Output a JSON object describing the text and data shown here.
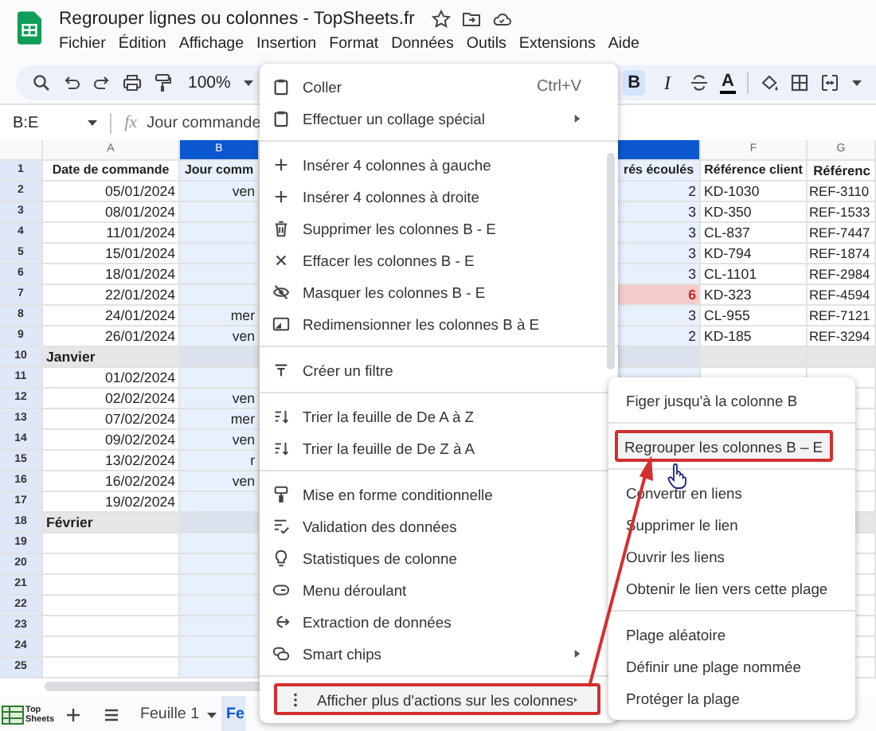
{
  "app": {
    "title": "Regrouper lignes ou colonnes - TopSheets.fr",
    "menus": [
      "Fichier",
      "Édition",
      "Affichage",
      "Insertion",
      "Format",
      "Données",
      "Outils",
      "Extensions",
      "Aide"
    ]
  },
  "toolbar": {
    "zoom": "100%",
    "format_buttons": [
      {
        "label": "B",
        "selected": true
      },
      {
        "label": "I",
        "selected": false
      }
    ],
    "text_color": "A"
  },
  "formula_bar": {
    "range": "B:E",
    "fx": "fx",
    "content": "Jour commande"
  },
  "grid": {
    "columns": [
      {
        "label": "A",
        "selected": false
      },
      {
        "label": "B",
        "selected": true
      },
      {
        "selected": true
      },
      {
        "label": "F",
        "selected": false
      },
      {
        "label": "G",
        "selected": false
      }
    ],
    "rows": [
      {
        "number": "1",
        "kind": "header",
        "cells": [
          "Date de commande",
          "Jour comm",
          "rés écoulés",
          "Référence client",
          "Référenc"
        ],
        "alert": false
      },
      {
        "number": "2",
        "kind": "data",
        "cells": [
          "05/01/2024",
          "ven",
          "2",
          "KD-1030",
          "REF-3110"
        ],
        "alert": false
      },
      {
        "number": "3",
        "kind": "data",
        "cells": [
          "08/01/2024",
          null,
          "3",
          "KD-350",
          "REF-1533"
        ],
        "alert": false
      },
      {
        "number": "4",
        "kind": "data",
        "cells": [
          "11/01/2024",
          null,
          "3",
          "CL-837",
          "REF-7447"
        ],
        "alert": false
      },
      {
        "number": "5",
        "kind": "data",
        "cells": [
          "15/01/2024",
          null,
          "3",
          "KD-794",
          "REF-1874"
        ],
        "alert": false
      },
      {
        "number": "6",
        "kind": "data",
        "cells": [
          "18/01/2024",
          null,
          "3",
          "CL-1101",
          "REF-2984"
        ],
        "alert": false
      },
      {
        "number": "7",
        "kind": "data",
        "cells": [
          "22/01/2024",
          null,
          "6",
          "KD-323",
          "REF-4594"
        ],
        "alert": true
      },
      {
        "number": "8",
        "kind": "data",
        "cells": [
          "24/01/2024",
          "mer",
          "3",
          "CL-955",
          "REF-7121"
        ],
        "alert": false
      },
      {
        "number": "9",
        "kind": "data",
        "cells": [
          "26/01/2024",
          "ven",
          "2",
          "KD-185",
          "REF-3294"
        ],
        "alert": false
      },
      {
        "number": "10",
        "kind": "group",
        "cells": [
          "Janvier",
          null,
          null,
          null,
          null
        ],
        "alert": false
      },
      {
        "number": "11",
        "kind": "data",
        "cells": [
          "01/02/2024",
          null,
          null,
          null,
          null
        ]
      },
      {
        "number": "12",
        "kind": "data",
        "cells": [
          "02/02/2024",
          "ven",
          null,
          null,
          null
        ]
      },
      {
        "number": "13",
        "kind": "data",
        "cells": [
          "07/02/2024",
          "mer",
          null,
          null,
          null
        ]
      },
      {
        "number": "14",
        "kind": "data",
        "cells": [
          "09/02/2024",
          "ven",
          null,
          null,
          null
        ]
      },
      {
        "number": "15",
        "kind": "data",
        "cells": [
          "13/02/2024",
          "r",
          null,
          null,
          null
        ]
      },
      {
        "number": "16",
        "kind": "data",
        "cells": [
          "16/02/2024",
          "ven",
          null,
          null,
          null
        ]
      },
      {
        "number": "17",
        "kind": "data",
        "cells": [
          "19/02/2024",
          null,
          null,
          null,
          null
        ]
      },
      {
        "number": "18",
        "kind": "group",
        "cells": [
          "Février",
          null,
          null,
          null,
          null
        ]
      },
      {
        "number": "19",
        "kind": "data",
        "cells": [
          null,
          null,
          null,
          null,
          null
        ]
      },
      {
        "number": "20",
        "kind": "data",
        "cells": [
          null,
          null,
          null,
          null,
          null
        ]
      },
      {
        "number": "21",
        "kind": "data",
        "cells": [
          null,
          null,
          null,
          null,
          null
        ]
      },
      {
        "number": "22",
        "kind": "data",
        "cells": [
          null,
          null,
          null,
          null,
          null
        ]
      },
      {
        "number": "23",
        "kind": "data",
        "cells": [
          null,
          null,
          null,
          null,
          null
        ]
      },
      {
        "number": "24",
        "kind": "data",
        "cells": [
          null,
          null,
          null,
          null,
          null
        ]
      },
      {
        "number": "25",
        "kind": "data",
        "cells": [
          null,
          null,
          null,
          null,
          null
        ]
      }
    ]
  },
  "sheet_bar": {
    "logo_text": "Top Sheets",
    "tabs": [
      {
        "label": "Feuille 1",
        "selected": false
      },
      {
        "label": "Fe",
        "selected": true
      }
    ]
  },
  "context_menu": {
    "groups": [
      [
        {
          "label": "Coller",
          "shortcut": "Ctrl+V",
          "submenu": false,
          "highlighted": false
        },
        {
          "label": "Effectuer un collage spécial",
          "submenu": true,
          "highlighted": false
        }
      ],
      [
        {
          "label": "Insérer 4 colonnes à gauche",
          "submenu": false,
          "highlighted": false
        },
        {
          "label": "Insérer 4 colonnes à droite",
          "submenu": false,
          "highlighted": false
        },
        {
          "label": "Supprimer les colonnes B - E",
          "submenu": false,
          "highlighted": false
        },
        {
          "label": "Effacer les colonnes B - E",
          "submenu": false,
          "highlighted": false
        },
        {
          "label": "Masquer les colonnes B - E",
          "submenu": false,
          "highlighted": false
        },
        {
          "label": "Redimensionner les colonnes B à E",
          "submenu": false,
          "highlighted": false
        }
      ],
      [
        {
          "label": "Créer un filtre",
          "submenu": false,
          "highlighted": false
        }
      ],
      [
        {
          "label": "Trier la feuille de De A à Z",
          "submenu": false,
          "highlighted": false
        },
        {
          "label": "Trier la feuille de De Z à A",
          "submenu": false,
          "highlighted": false
        }
      ],
      [
        {
          "label": "Mise en forme conditionnelle",
          "submenu": false,
          "highlighted": false
        },
        {
          "label": "Validation des données",
          "submenu": false,
          "highlighted": false
        },
        {
          "label": "Statistiques de colonne",
          "submenu": false,
          "highlighted": false
        },
        {
          "label": "Menu déroulant",
          "submenu": false,
          "highlighted": false
        },
        {
          "label": "Extraction de données",
          "submenu": false,
          "highlighted": false
        },
        {
          "label": "Smart chips",
          "submenu": true,
          "highlighted": false
        }
      ],
      [
        {
          "label": "Afficher plus d'actions sur les colonnes",
          "submenu": true,
          "highlighted": true
        }
      ]
    ]
  },
  "submenu": {
    "groups": [
      [
        {
          "label": "Figer jusqu'à la colonne B",
          "highlighted": false
        }
      ],
      [
        {
          "label": "Regrouper les colonnes B – E",
          "highlighted": true
        }
      ],
      [
        {
          "label": "Convertir en liens",
          "highlighted": false
        },
        {
          "label": "Supprimer le lien",
          "highlighted": false
        },
        {
          "label": "Ouvrir les liens",
          "highlighted": false
        },
        {
          "label": "Obtenir le lien vers cette plage",
          "highlighted": false
        }
      ],
      [
        {
          "label": "Plage aléatoire",
          "highlighted": false
        },
        {
          "label": "Définir une plage nommée",
          "highlighted": false
        },
        {
          "label": "Protéger la plage",
          "highlighted": false
        }
      ]
    ]
  }
}
